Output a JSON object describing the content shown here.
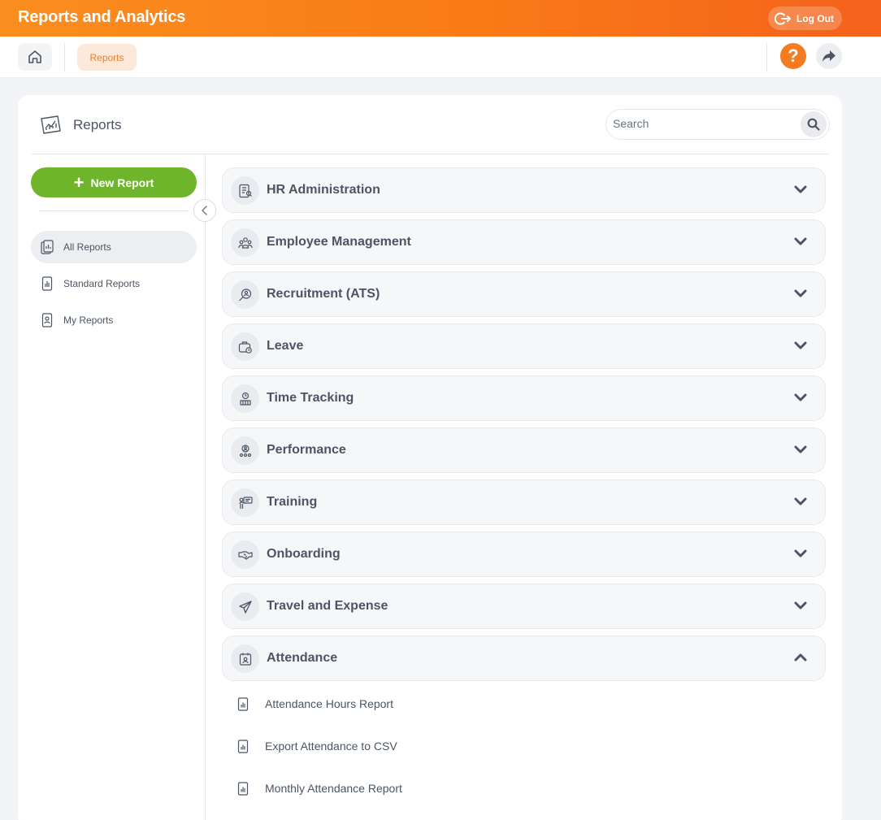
{
  "app": {
    "title": "Reports and Analytics",
    "logout_label": "Log Out"
  },
  "nav": {
    "breadcrumb": "Reports",
    "help_label": "?"
  },
  "reports": {
    "title": "Reports",
    "search_placeholder": "Search",
    "new_report_label": "New Report",
    "sidebar": [
      {
        "label": "All Reports",
        "icon": "all-reports-icon",
        "active": true
      },
      {
        "label": "Standard Reports",
        "icon": "standard-reports-icon",
        "active": false
      },
      {
        "label": "My Reports",
        "icon": "my-reports-icon",
        "active": false
      }
    ],
    "sections": [
      {
        "label": "HR Administration",
        "icon": "hr-administration-icon",
        "expanded": false
      },
      {
        "label": "Employee Management",
        "icon": "employee-management-icon",
        "expanded": false
      },
      {
        "label": "Recruitment (ATS)",
        "icon": "recruitment-icon",
        "expanded": false
      },
      {
        "label": "Leave",
        "icon": "leave-icon",
        "expanded": false
      },
      {
        "label": "Time Tracking",
        "icon": "time-tracking-icon",
        "expanded": false
      },
      {
        "label": "Performance",
        "icon": "performance-icon",
        "expanded": false
      },
      {
        "label": "Training",
        "icon": "training-icon",
        "expanded": false
      },
      {
        "label": "Onboarding",
        "icon": "onboarding-icon",
        "expanded": false
      },
      {
        "label": "Travel and Expense",
        "icon": "travel-expense-icon",
        "expanded": false
      },
      {
        "label": "Attendance",
        "icon": "attendance-icon",
        "expanded": true
      }
    ],
    "attendance_reports": [
      "Attendance Hours Report",
      "Export Attendance to CSV",
      "Monthly Attendance Report"
    ]
  },
  "colors": {
    "brand_orange": "#f47b20",
    "accent_green": "#6fb52c",
    "text": "#4b5563"
  }
}
